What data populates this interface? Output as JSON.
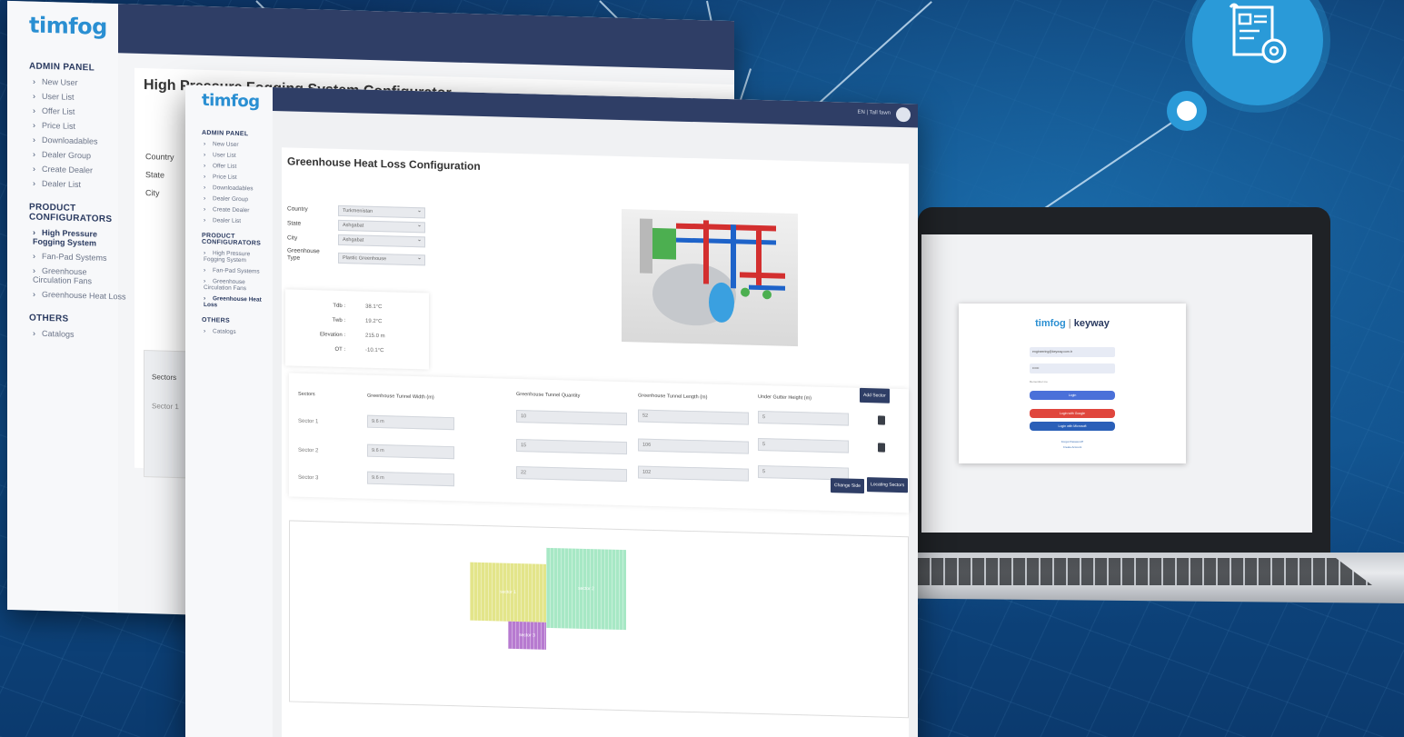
{
  "back_window": {
    "logo": {
      "a": "tim",
      "b": "fog"
    },
    "admin_heading": "ADMIN PANEL",
    "admin_items": [
      "New User",
      "User List",
      "Offer List",
      "Price List",
      "Downloadables",
      "Dealer Group",
      "Create Dealer",
      "Dealer List"
    ],
    "product_heading_1": "PRODUCT",
    "product_heading_2": "CONFIGURATORS",
    "product_items": [
      "High Pressure Fogging System",
      "Fan-Pad Systems",
      "Greenhouse Circulation Fans",
      "Greenhouse Heat Loss"
    ],
    "others_heading": "OTHERS",
    "others_items": [
      "Catalogs"
    ],
    "title": "High Pressure Fogging System Configurator",
    "fields": [
      "Country",
      "State",
      "City"
    ],
    "sectors_label": "Sectors",
    "sector_1": "Sector 1"
  },
  "front_window": {
    "logo": {
      "a": "tim",
      "b": "fog"
    },
    "user_label": "EN | Tall fawn",
    "admin_heading": "ADMIN PANEL",
    "admin_items": [
      "New User",
      "User List",
      "Offer List",
      "Price List",
      "Downloadables",
      "Dealer Group",
      "Create Dealer",
      "Dealer List"
    ],
    "product_heading_1": "PRODUCT",
    "product_heading_2": "CONFIGURATORS",
    "product_items": [
      "High Pressure Fogging System",
      "Fan-Pad Systems",
      "Greenhouse Circulation Fans",
      "Greenhouse Heat Loss"
    ],
    "others_heading": "OTHERS",
    "others_items": [
      "Catalogs"
    ],
    "title": "Greenhouse Heat Loss Configuration",
    "form": {
      "country_label": "Country",
      "country_value": "Turkmenistan",
      "state_label": "State",
      "state_value": "Ashgabat",
      "city_label": "City",
      "city_value": "Ashgabat",
      "type_label_1": "Greenhouse",
      "type_label_2": "Type",
      "type_value": "Plastic Greenhouse"
    },
    "climate": {
      "tdb_label": "Tdb :",
      "tdb_value": "38.1°C",
      "twb_label": "Twb :",
      "twb_value": "19.2°C",
      "elevation_label": "Elevation :",
      "elevation_value": "215.0 m",
      "ot_label": "OT :",
      "ot_value": "-10.1°C"
    },
    "table": {
      "headers": [
        "Sectors",
        "Greenhouse Tunnel Width (m)",
        "Greenhouse Tunnel Quantity",
        "Greenhouse Tunnel Length (m)",
        "Under Gutter Height (m)"
      ],
      "add_button": "Add Sector",
      "rows": [
        {
          "label": "Sector 1",
          "width": "9.6 m",
          "qty": "10",
          "length": "52",
          "height": "5"
        },
        {
          "label": "Sector 2",
          "width": "9.6 m",
          "qty": "15",
          "length": "106",
          "height": "5"
        },
        {
          "label": "Sector 3",
          "width": "9.6 m",
          "qty": "22",
          "length": "102",
          "height": "5"
        }
      ],
      "change_side_button": "Change Side",
      "locating_button": "Locating Sectors"
    },
    "viz": {
      "sector_1": "sector 1",
      "sector_2": "sector 2",
      "sector_3": "sector 3",
      "colors": {
        "sector_1": "#e3e58a",
        "sector_2": "#a7e8c5",
        "sector_3": "#b77ad0"
      }
    }
  },
  "laptop": {
    "logo_a": "tim",
    "logo_b": "fog",
    "logo_sep": "|",
    "logo_c": "keyway",
    "email_value": "engineering@keyway.com.tr",
    "password_value": "••••••",
    "remember_label": "Remember me",
    "login_button": "Login",
    "google_button": "Login with Google",
    "microsoft_button": "Login with Microsoft",
    "forgot_link": "Forgot Password?",
    "signup_link": "Create Account"
  },
  "colors": {
    "navbar": "#2f3e66",
    "accent": "#2a8fd2",
    "bubble": "#2a9ad8",
    "google": "#e0463d",
    "primary_btn": "#4a70d9"
  },
  "icons": [
    "settings-document-icon",
    "trash-icon",
    "chevron-right-icon",
    "avatar-icon"
  ]
}
